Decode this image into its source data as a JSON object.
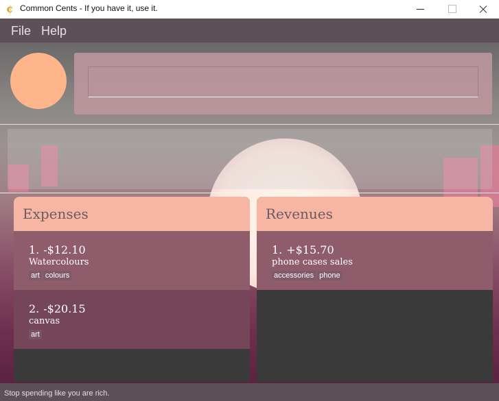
{
  "window": {
    "title": "Common Cents - If you have it, use it.",
    "icon": "cent-icon"
  },
  "menu": {
    "file": "File",
    "help": "Help"
  },
  "command": {
    "value": "",
    "placeholder": ""
  },
  "expenses": {
    "title": "Expenses",
    "items": [
      {
        "index": "1.",
        "amount": "-$12.10",
        "description": "Watercolours",
        "tags": [
          "art",
          "colours"
        ]
      },
      {
        "index": "2.",
        "amount": "-$20.15",
        "description": "canvas",
        "tags": [
          "art"
        ]
      }
    ]
  },
  "revenues": {
    "title": "Revenues",
    "items": [
      {
        "index": "1.",
        "amount": "+$15.70",
        "description": "phone cases sales",
        "tags": [
          "accessories",
          "phone"
        ]
      }
    ]
  },
  "status": {
    "text": "Stop spending like you are rich."
  },
  "colors": {
    "accent": "#f7b5a4",
    "avatar": "#ffb58c",
    "menubar": "#5e5058",
    "list_bg": "#3a3a3a"
  }
}
